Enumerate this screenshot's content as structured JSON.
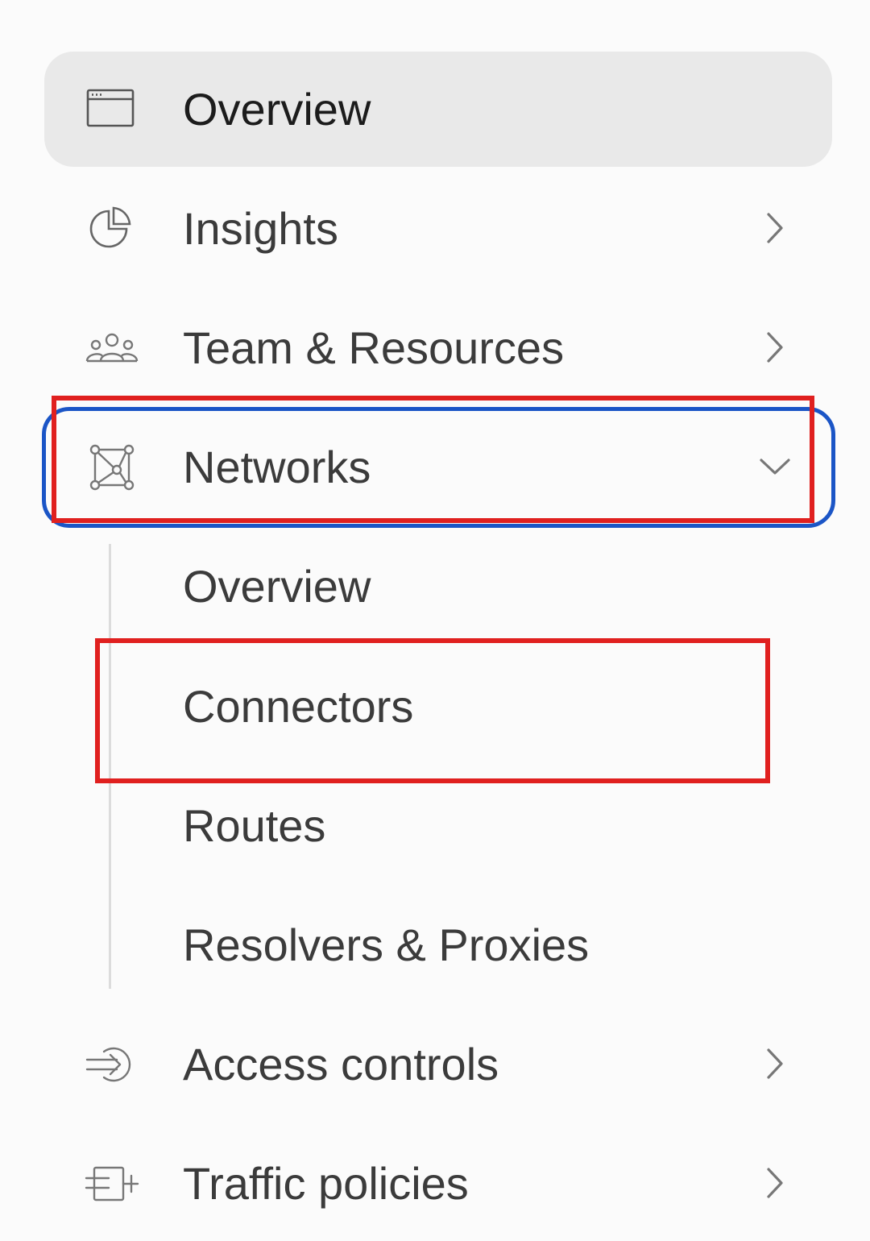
{
  "sidebar": {
    "overview": {
      "label": "Overview",
      "icon": "browser-window-icon"
    },
    "insights": {
      "label": "Insights",
      "icon": "pie-chart-icon"
    },
    "team": {
      "label": "Team & Resources",
      "icon": "users-group-icon"
    },
    "networks": {
      "label": "Networks",
      "icon": "network-graph-icon",
      "expanded": true,
      "children": [
        {
          "label": "Overview"
        },
        {
          "label": "Connectors"
        },
        {
          "label": "Routes"
        },
        {
          "label": "Resolvers & Proxies"
        }
      ]
    },
    "access": {
      "label": "Access controls",
      "icon": "sign-in-arrow-icon"
    },
    "traffic": {
      "label": "Traffic policies",
      "icon": "traffic-route-icon"
    }
  },
  "annotations": {
    "blue_highlight_color": "#1b55c6",
    "red_highlight_color": "#e0201f"
  }
}
